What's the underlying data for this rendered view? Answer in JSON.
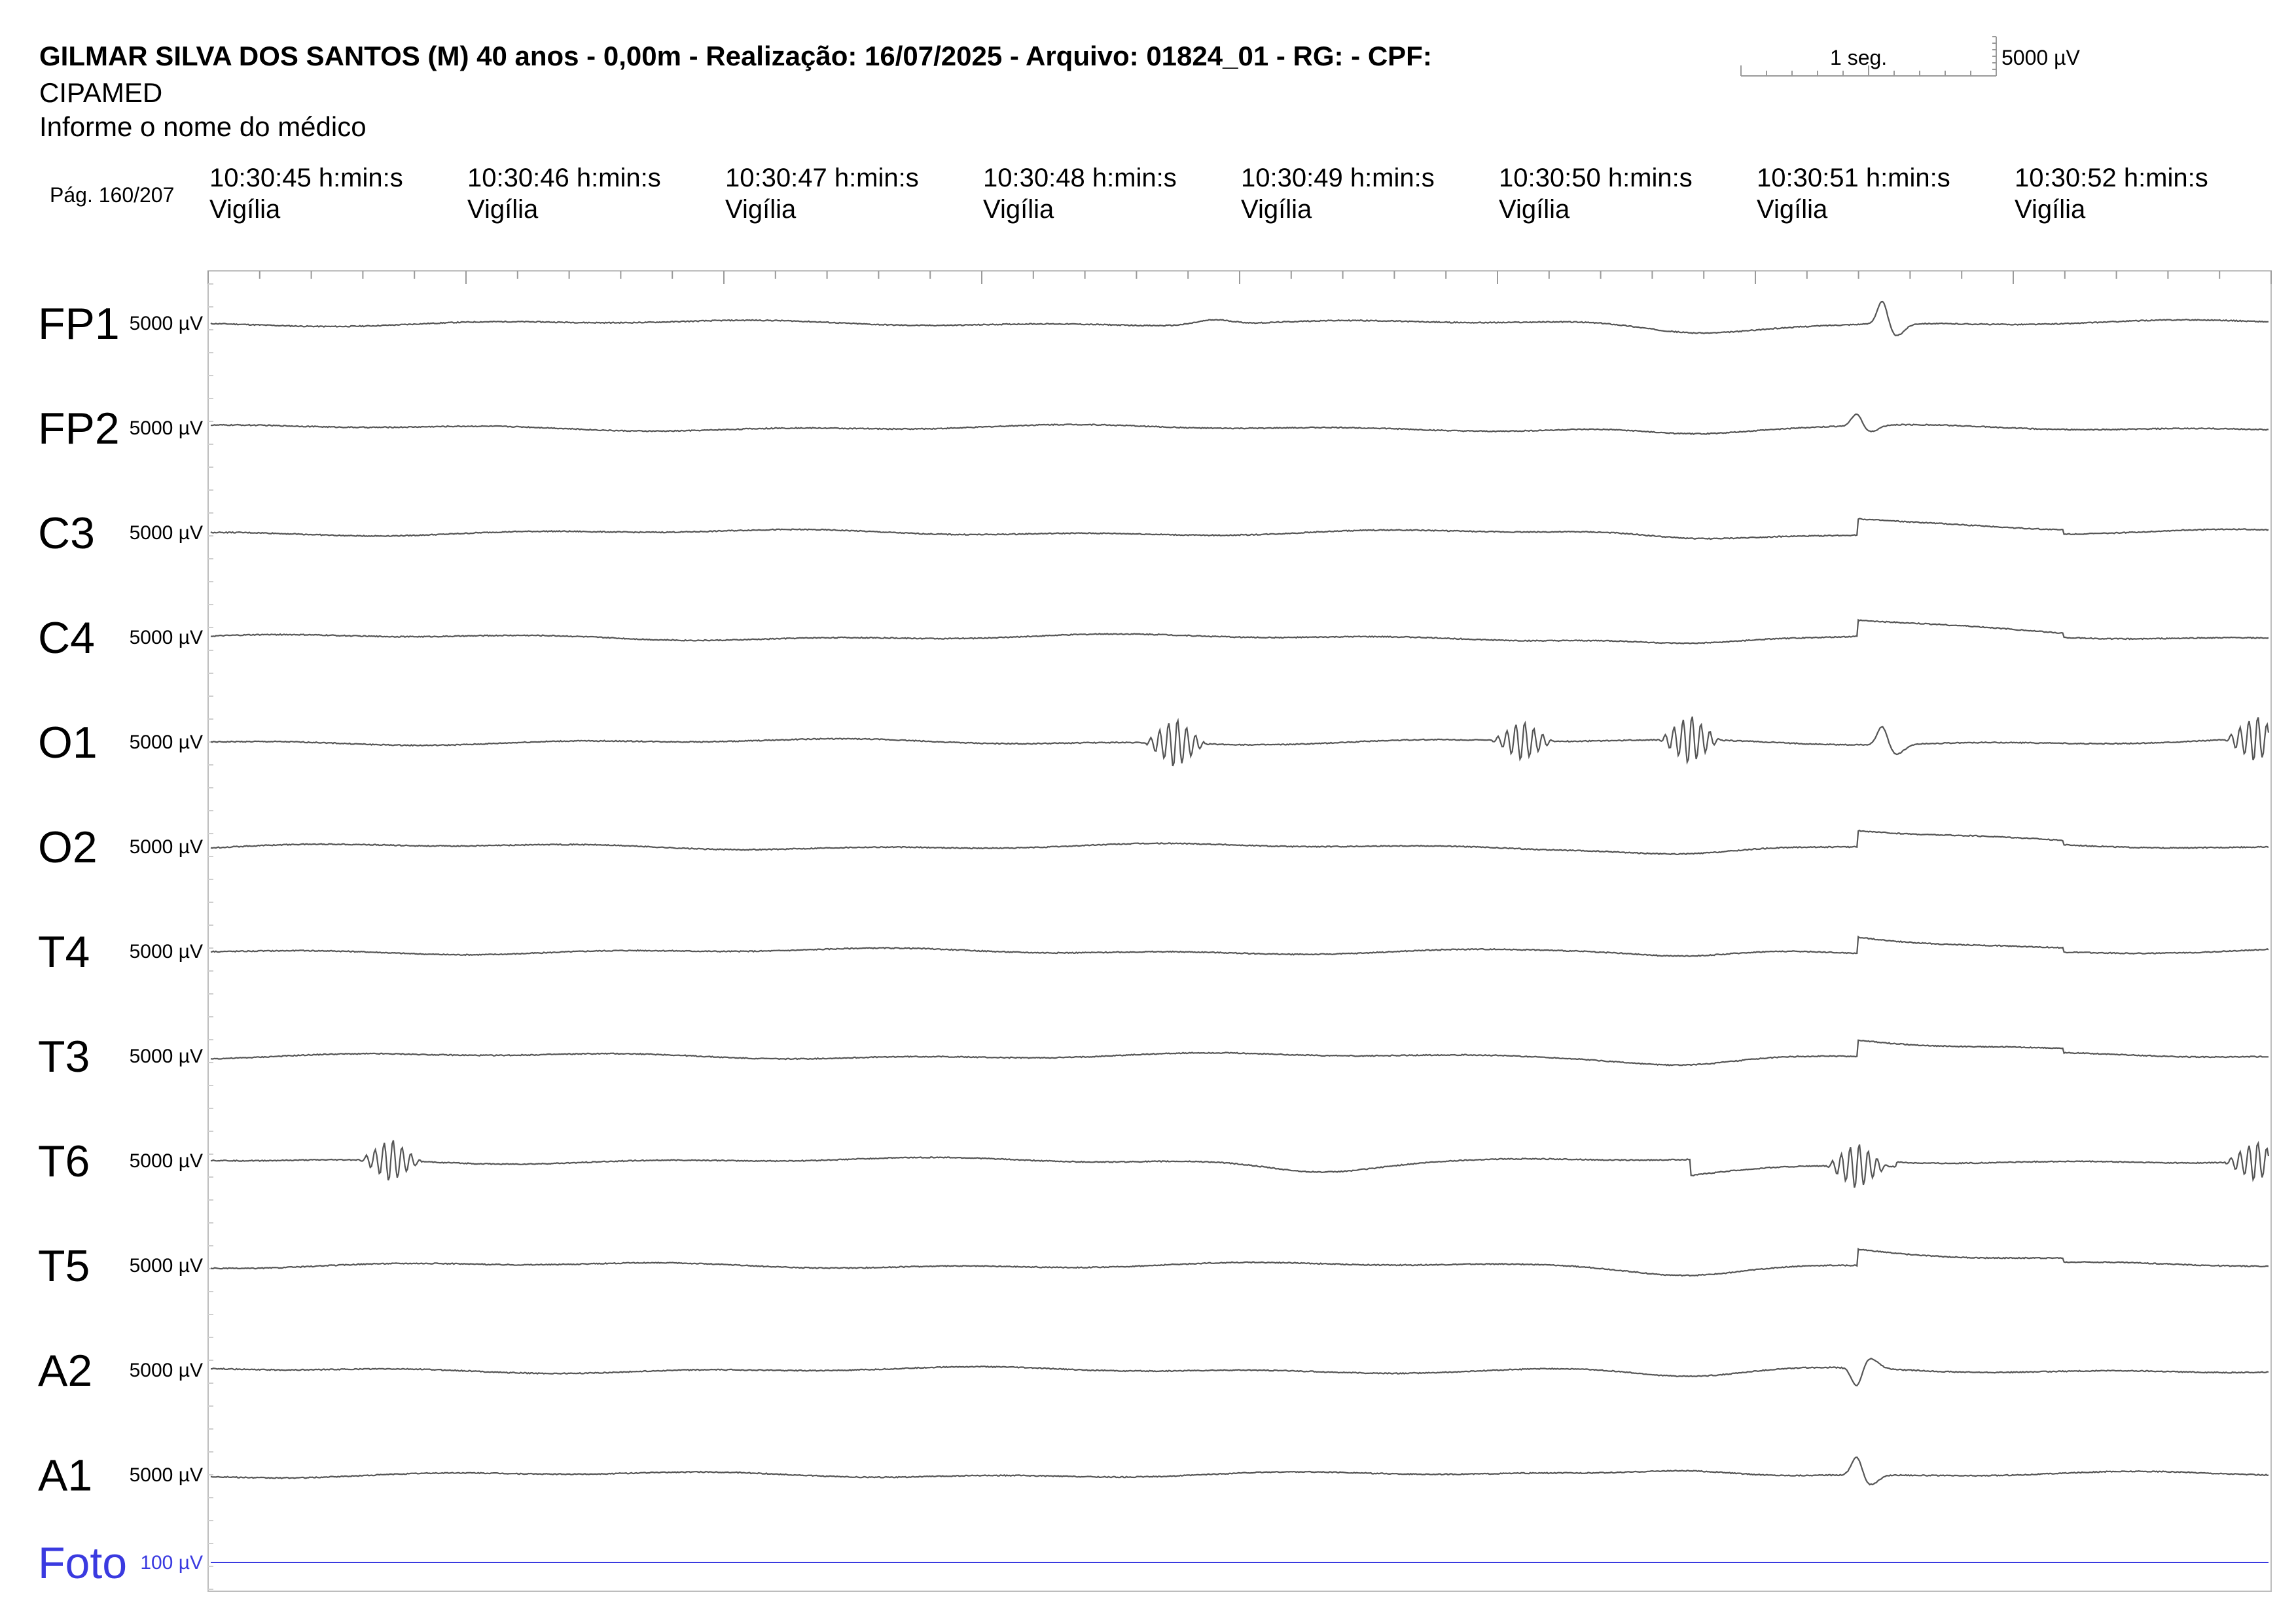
{
  "header": {
    "title": "GILMAR SILVA DOS SANTOS (M) 40 anos - 0,00m - Realização: 16/07/2025 - Arquivo: 01824_01 - RG:  - CPF:",
    "clinic": "CIPAMED",
    "doctor": "Informe o nome do médico",
    "page": "Pág. 160/207"
  },
  "scale": {
    "time_label": "1 seg.",
    "amplitude_label": "5000 µV"
  },
  "timeline": [
    {
      "time": "10:30:45 h:min:s",
      "state": "Vigília"
    },
    {
      "time": "10:30:46 h:min:s",
      "state": "Vigília"
    },
    {
      "time": "10:30:47 h:min:s",
      "state": "Vigília"
    },
    {
      "time": "10:30:48 h:min:s",
      "state": "Vigília"
    },
    {
      "time": "10:30:49 h:min:s",
      "state": "Vigília"
    },
    {
      "time": "10:30:50 h:min:s",
      "state": "Vigília"
    },
    {
      "time": "10:30:51 h:min:s",
      "state": "Vigília"
    },
    {
      "time": "10:30:52 h:min:s",
      "state": "Vigília"
    }
  ],
  "colors": {
    "trace": "#555555",
    "photic": "#3a3ae0",
    "grid": "#9a9a9a",
    "label": "#000000"
  },
  "chart_data": {
    "type": "line",
    "x_range_seconds": [
      0,
      8
    ],
    "channels": [
      {
        "name": "FP1",
        "sensitivity": "5000 µV",
        "color": "#000000",
        "events": [
          {
            "t": 3.9,
            "amp": 0.3,
            "kind": "bump"
          },
          {
            "t": 5.75,
            "amp": -0.5,
            "kind": "slow"
          },
          {
            "t": 6.5,
            "amp": 1.5,
            "kind": "spike"
          }
        ]
      },
      {
        "name": "FP2",
        "sensitivity": "5000 µV",
        "color": "#000000",
        "events": [
          {
            "t": 5.75,
            "amp": -0.4,
            "kind": "slow"
          },
          {
            "t": 6.4,
            "amp": 0.8,
            "kind": "spike"
          }
        ]
      },
      {
        "name": "C3",
        "sensitivity": "5000 µV",
        "color": "#000000",
        "events": [
          {
            "t": 5.75,
            "amp": -0.4,
            "kind": "slow"
          },
          {
            "t": 6.4,
            "amp": 1.2,
            "kind": "step"
          }
        ]
      },
      {
        "name": "C4",
        "sensitivity": "5000 µV",
        "color": "#000000",
        "events": [
          {
            "t": 5.75,
            "amp": -0.4,
            "kind": "slow"
          },
          {
            "t": 6.4,
            "amp": 1.2,
            "kind": "step"
          }
        ]
      },
      {
        "name": "O1",
        "sensitivity": "5000 µV",
        "color": "#000000",
        "events": [
          {
            "t": 3.75,
            "amp": 1.5,
            "kind": "burst"
          },
          {
            "t": 5.1,
            "amp": 1.2,
            "kind": "burst"
          },
          {
            "t": 5.75,
            "amp": 1.5,
            "kind": "burst"
          },
          {
            "t": 6.5,
            "amp": 1.2,
            "kind": "spike"
          },
          {
            "t": 7.95,
            "amp": 1.4,
            "kind": "burst"
          }
        ]
      },
      {
        "name": "O2",
        "sensitivity": "5000 µV",
        "color": "#000000",
        "events": [
          {
            "t": 5.75,
            "amp": -0.4,
            "kind": "slow"
          },
          {
            "t": 6.4,
            "amp": 1.2,
            "kind": "step"
          }
        ]
      },
      {
        "name": "T4",
        "sensitivity": "5000 µV",
        "color": "#000000",
        "events": [
          {
            "t": 5.75,
            "amp": -0.4,
            "kind": "slow"
          },
          {
            "t": 6.4,
            "amp": 1.2,
            "kind": "step"
          }
        ]
      },
      {
        "name": "T3",
        "sensitivity": "5000 µV",
        "color": "#000000",
        "events": [
          {
            "t": 5.75,
            "amp": -0.4,
            "kind": "slow"
          },
          {
            "t": 6.4,
            "amp": 1.2,
            "kind": "step"
          }
        ]
      },
      {
        "name": "T6",
        "sensitivity": "5000 µV",
        "color": "#000000",
        "events": [
          {
            "t": 0.7,
            "amp": 1.3,
            "kind": "burst"
          },
          {
            "t": 4.3,
            "amp": -0.5,
            "kind": "slow"
          },
          {
            "t": 5.75,
            "amp": -1.2,
            "kind": "step"
          },
          {
            "t": 6.4,
            "amp": 1.4,
            "kind": "burst"
          },
          {
            "t": 7.95,
            "amp": 1.2,
            "kind": "burst"
          }
        ]
      },
      {
        "name": "T5",
        "sensitivity": "5000 µV",
        "color": "#000000",
        "events": [
          {
            "t": 5.75,
            "amp": -0.4,
            "kind": "slow"
          },
          {
            "t": 6.4,
            "amp": 1.2,
            "kind": "step"
          }
        ]
      },
      {
        "name": "A2",
        "sensitivity": "5000 µV",
        "color": "#000000",
        "events": [
          {
            "t": 5.75,
            "amp": -0.4,
            "kind": "slow"
          },
          {
            "t": 6.4,
            "amp": -1.2,
            "kind": "spike"
          }
        ]
      },
      {
        "name": "A1",
        "sensitivity": "5000 µV",
        "color": "#000000",
        "events": [
          {
            "t": 5.75,
            "amp": 0.4,
            "kind": "slow"
          },
          {
            "t": 6.4,
            "amp": 1.2,
            "kind": "spike"
          }
        ]
      },
      {
        "name": "Foto",
        "sensitivity": "100 µV",
        "color": "#3a3ae0",
        "events": []
      }
    ]
  }
}
